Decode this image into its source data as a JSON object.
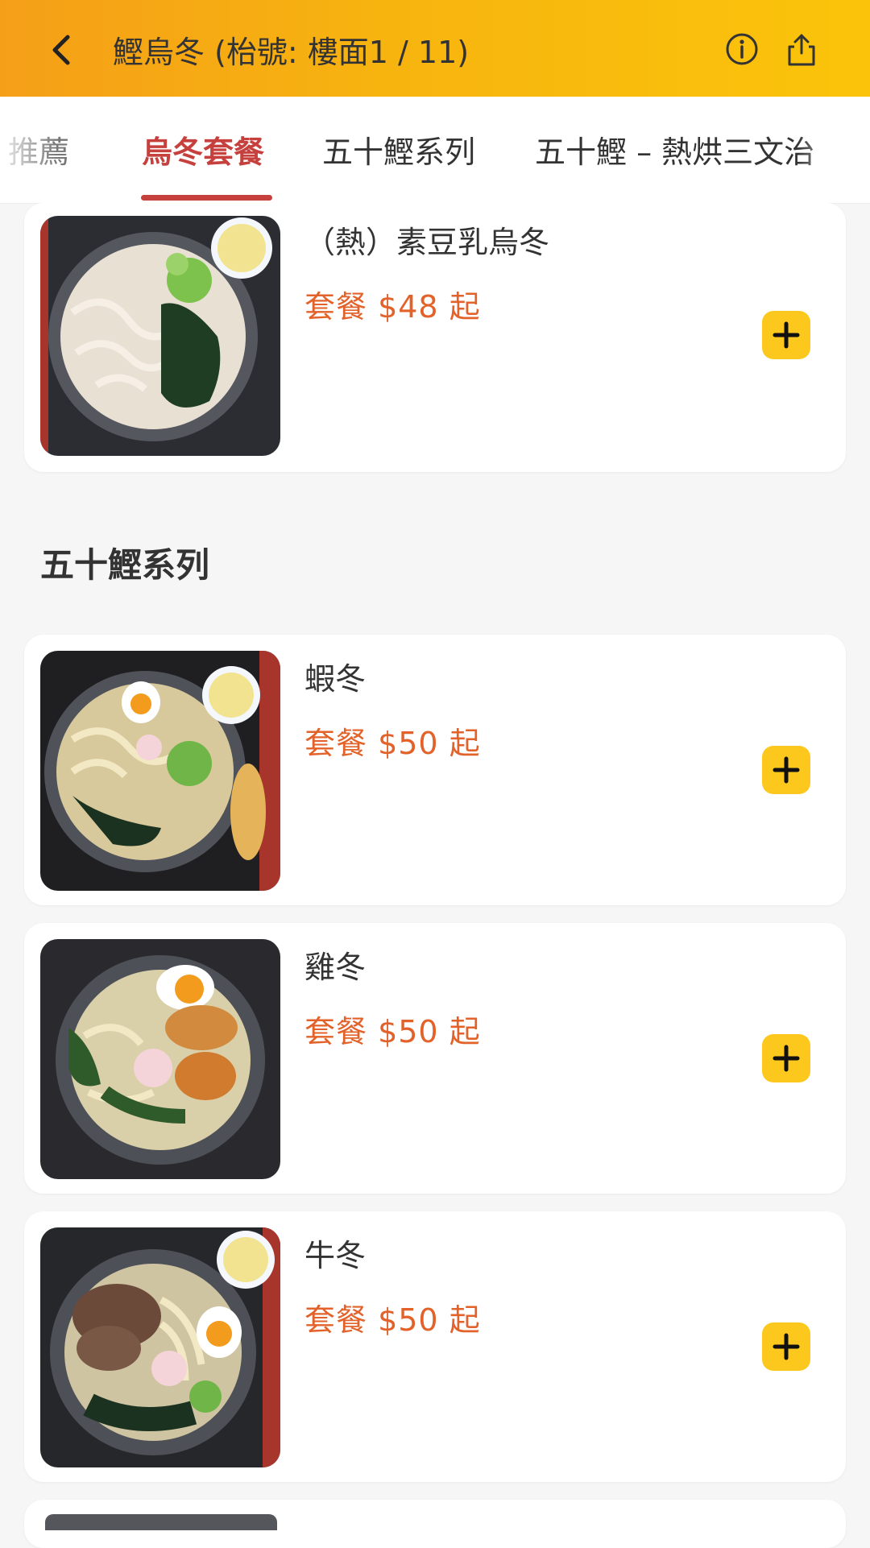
{
  "header": {
    "title": "鰹烏冬 (枱號: 樓面1 / 11)",
    "back_icon": "chevron-left-icon",
    "info_icon": "info-icon",
    "share_icon": "share-icon",
    "gradient_colors": [
      "#f59f18",
      "#fbc40a"
    ]
  },
  "tabs": [
    {
      "label": "推薦",
      "state": "partial"
    },
    {
      "label": "烏冬套餐",
      "state": "active"
    },
    {
      "label": "五十鰹系列",
      "state": "normal"
    },
    {
      "label": "五十鰹 – 熱烘三文治",
      "state": "normal"
    }
  ],
  "accent_color": "#c6403d",
  "price_color": "#e2622a",
  "add_button_color": "#fcc81e",
  "items_top": [
    {
      "name": "（熱）素豆乳烏冬",
      "price": "套餐 $48 起"
    }
  ],
  "section": {
    "title": "五十鰹系列",
    "items": [
      {
        "name": "蝦冬",
        "price": "套餐 $50 起"
      },
      {
        "name": "雞冬",
        "price": "套餐 $50 起"
      },
      {
        "name": "牛冬",
        "price": "套餐 $50 起"
      }
    ]
  }
}
